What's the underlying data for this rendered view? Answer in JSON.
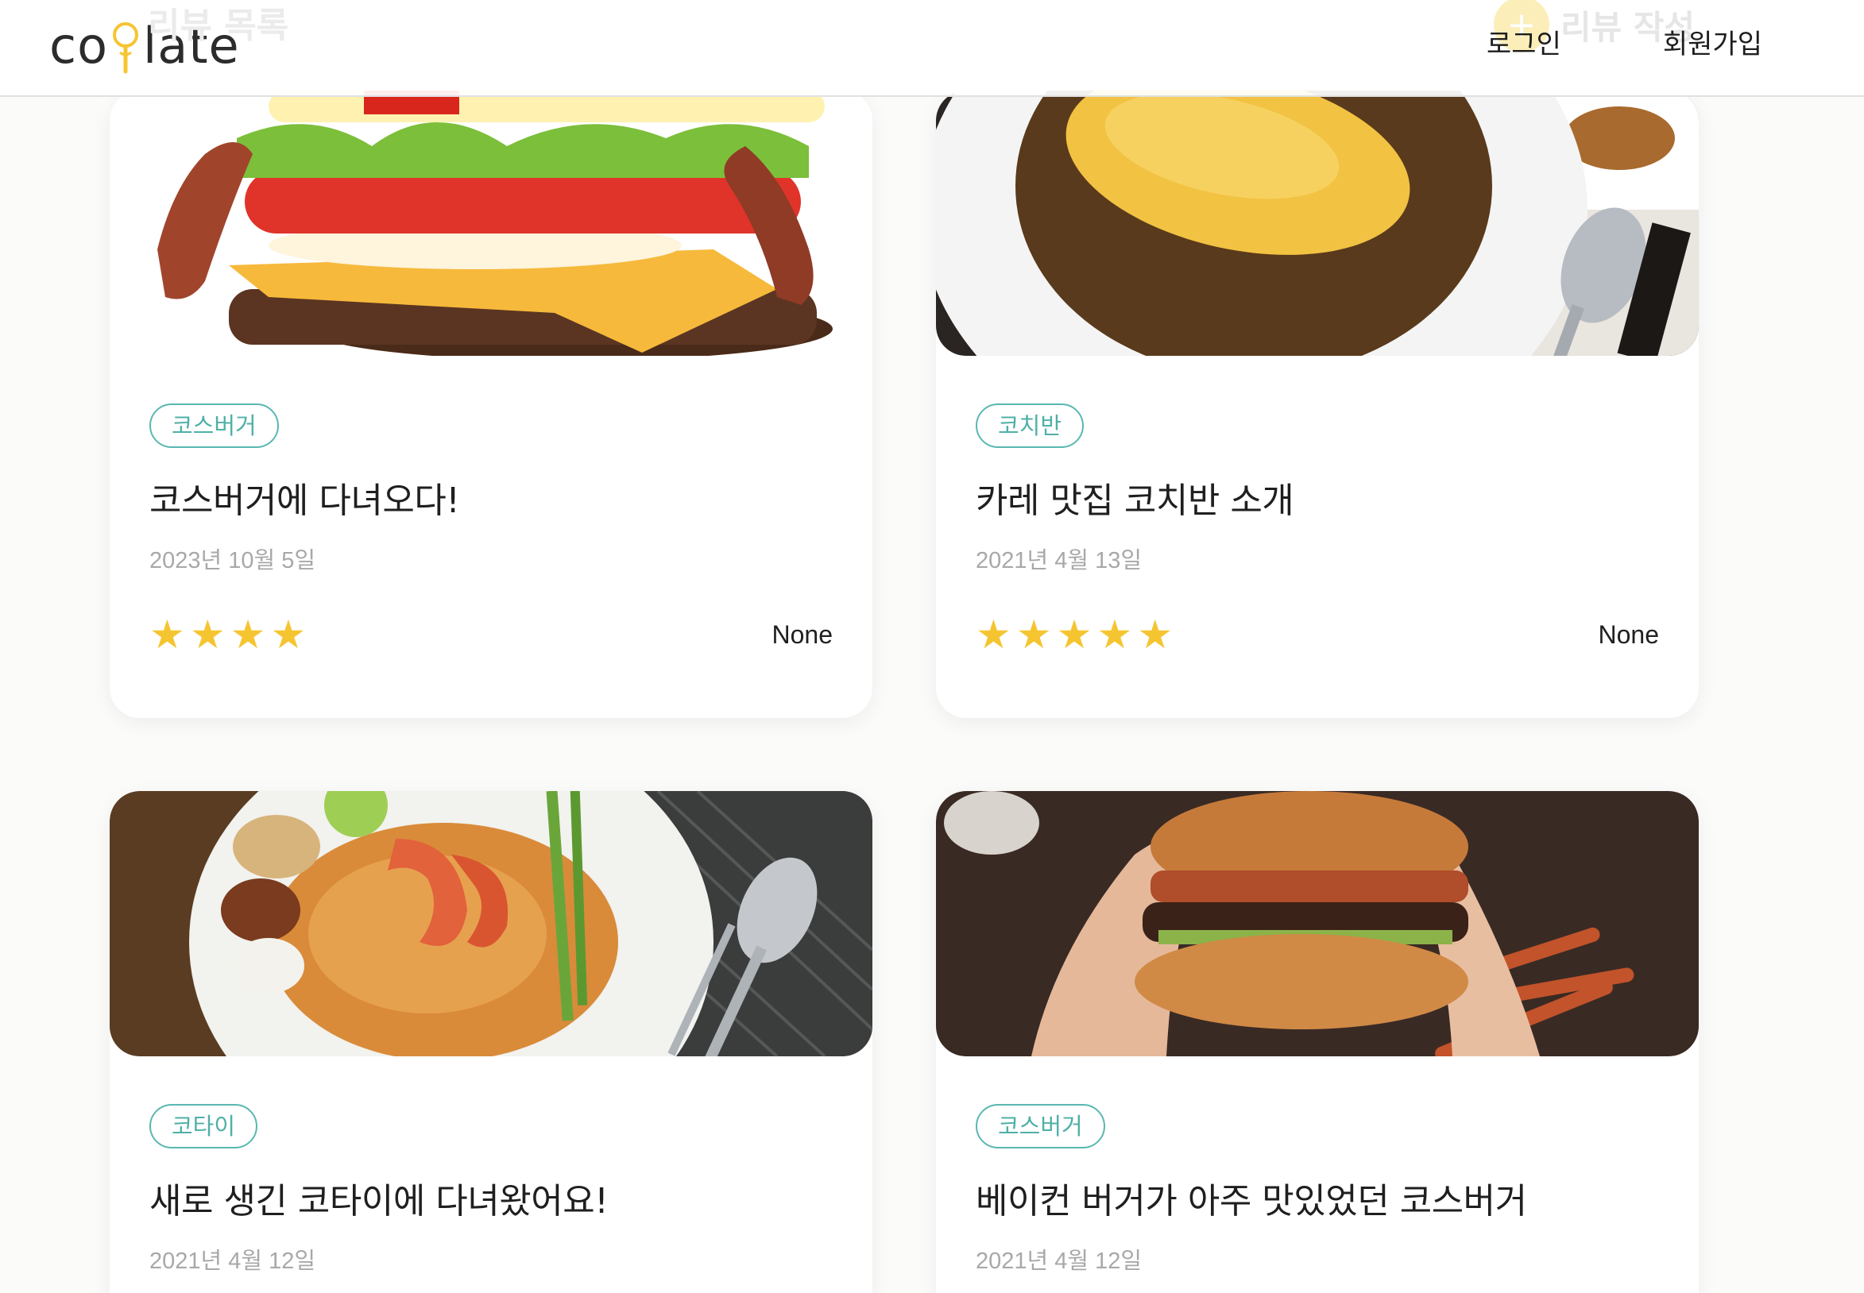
{
  "page": {
    "heading": "리뷰 목록",
    "write_button": {
      "icon": "plus-icon",
      "label": "리뷰 작성"
    }
  },
  "header": {
    "logo_text_left": "co",
    "logo_text_right": "late",
    "logo_icon": "key-icon",
    "nav": {
      "login": "로그인",
      "signup": "회원가입"
    }
  },
  "colors": {
    "accent": "#f5c531",
    "tag_border": "#59b8b0",
    "tag_text": "#4fb0a7",
    "date_text": "#a8a8a8",
    "background": "#fbfbfa"
  },
  "reviews": [
    {
      "image": "bacon-cheeseburger-photo",
      "tag": "코스버거",
      "title": "코스버거에 다녀오다!",
      "date": "2023년 10월 5일",
      "rating": 4,
      "author": "None"
    },
    {
      "image": "omelette-curry-photo",
      "tag": "코치반",
      "title": "카레 맛집 코치반 소개",
      "date": "2021년 4월 13일",
      "rating": 5,
      "author": "None"
    },
    {
      "image": "pad-thai-photo",
      "tag": "코타이",
      "title": "새로 생긴 코타이에 다녀왔어요!",
      "date": "2021년 4월 12일",
      "rating": null,
      "author": null
    },
    {
      "image": "bacon-burger-in-hands-photo",
      "tag": "코스버거",
      "title": "베이컨 버거가 아주 맛있었던 코스버거",
      "date": "2021년 4월 12일",
      "rating": null,
      "author": null
    }
  ]
}
